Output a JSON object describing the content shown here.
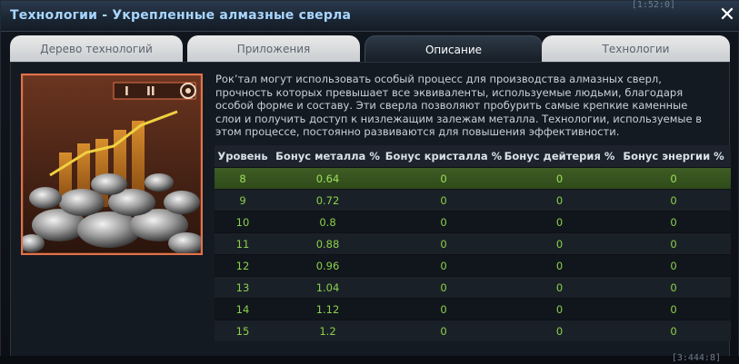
{
  "window": {
    "title": "Технологии - Укрепленные алмазные сверла",
    "close_glyph": "✕"
  },
  "tabs": [
    {
      "label": "Дерево технологий",
      "active": false
    },
    {
      "label": "Приложения",
      "active": false
    },
    {
      "label": "Описание",
      "active": true
    },
    {
      "label": "Технологии",
      "active": false
    }
  ],
  "image": {
    "badges": [
      "I",
      "II"
    ],
    "gear_icon": "gear-icon"
  },
  "description": "Рок’тал могут использовать особый процесс для производства алмазных сверл, прочность которых превышает все эквиваленты, используемые людьми, благодаря особой форме и составу. Эти сверла позволяют пробурить самые крепкие каменные слои и получить доступ к низлежащим залежам металла. Технологии, используемые в этом процессе, постоянно развиваются для повышения эффективности.",
  "table": {
    "headers": [
      "Уровень",
      "Бонус металла %",
      "Бонус кристалла %",
      "Бонус дейтерия %",
      "Бонус энергии %"
    ],
    "rows": [
      [
        "8",
        "0.64",
        "0",
        "0",
        "0"
      ],
      [
        "9",
        "0.72",
        "0",
        "0",
        "0"
      ],
      [
        "10",
        "0.8",
        "0",
        "0",
        "0"
      ],
      [
        "11",
        "0.88",
        "0",
        "0",
        "0"
      ],
      [
        "12",
        "0.96",
        "0",
        "0",
        "0"
      ],
      [
        "13",
        "1.04",
        "0",
        "0",
        "0"
      ],
      [
        "14",
        "1.12",
        "0",
        "0",
        "0"
      ],
      [
        "15",
        "1.2",
        "0",
        "0",
        "0"
      ]
    ]
  },
  "background": {
    "top_right_text": "[1:52:0]",
    "bottom_right_text": "[3:444:8]"
  },
  "colors": {
    "title": "#a9d6ff",
    "value_green": "#8ad04a",
    "selected_row": "#3e5c24",
    "image_border": "#e3724a"
  }
}
